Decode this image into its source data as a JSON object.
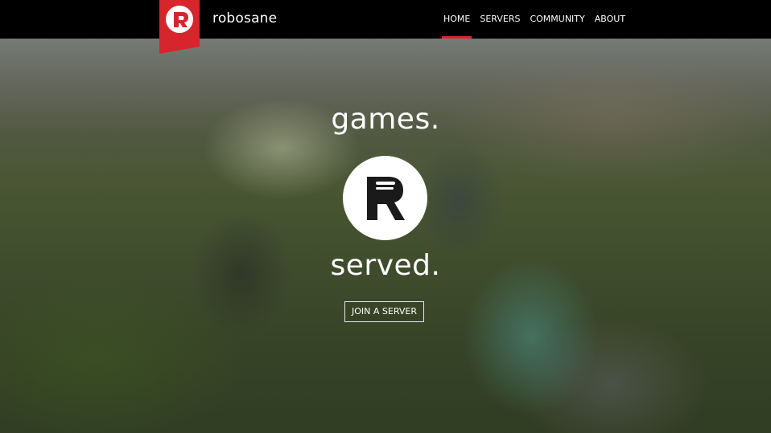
{
  "brand": {
    "name": "robosane",
    "logo_icon": "robosane-r-icon",
    "accent_color": "#d6252c"
  },
  "nav": {
    "items": [
      {
        "label": "HOME",
        "active": true
      },
      {
        "label": "SERVERS",
        "active": false
      },
      {
        "label": "COMMUNITY",
        "active": false
      },
      {
        "label": "ABOUT",
        "active": false
      }
    ]
  },
  "hero": {
    "line_top": "games.",
    "line_bottom": "served.",
    "center_icon": "robosane-r-icon",
    "cta_label": "JOIN A SERVER"
  }
}
